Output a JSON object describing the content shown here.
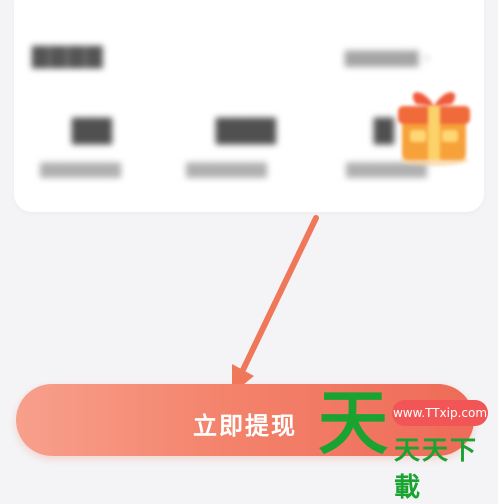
{
  "withdraw_button": {
    "label": "立即提现"
  },
  "watermark": {
    "logo_char": "天",
    "site_url": "www.TTxip.com",
    "site_name": "天天下載"
  },
  "colors": {
    "button_gradient_start": "#f7a08c",
    "button_gradient_end": "#ee6b58",
    "arrow": "#f0785a",
    "watermark_green": "#1ba332",
    "watermark_red": "#f25555"
  },
  "icons": {
    "gift": "gift-box-icon",
    "arrow": "pointer-arrow-icon"
  }
}
